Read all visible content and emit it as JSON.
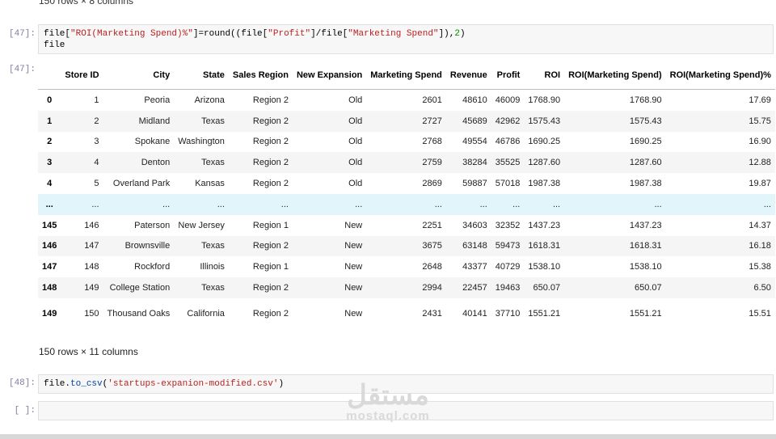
{
  "top_output": "150 rows × 8 columns",
  "cell47": {
    "prompt_in": "[47]:",
    "code_line1_parts": [
      "file[",
      "\"ROI(Marketing Spend)%\"",
      "]=round((file[",
      "\"Profit\"",
      "]/file[",
      "\"Marketing Spend\"",
      "]),",
      "2",
      ")"
    ],
    "code_line2": "file",
    "prompt_out": "[47]:"
  },
  "table": {
    "columns": [
      "",
      "Store ID",
      "City",
      "State",
      "Sales Region",
      "New Expansion",
      "Marketing Spend",
      "Revenue",
      "Profit",
      "ROI",
      "ROI(Marketing Spend)",
      "ROI(Marketing Spend)%"
    ],
    "rows": [
      [
        "0",
        "1",
        "Peoria",
        "Arizona",
        "Region 2",
        "Old",
        "2601",
        "48610",
        "46009",
        "1768.90",
        "1768.90",
        "17.69"
      ],
      [
        "1",
        "2",
        "Midland",
        "Texas",
        "Region 2",
        "Old",
        "2727",
        "45689",
        "42962",
        "1575.43",
        "1575.43",
        "15.75"
      ],
      [
        "2",
        "3",
        "Spokane",
        "Washington",
        "Region 2",
        "Old",
        "2768",
        "49554",
        "46786",
        "1690.25",
        "1690.25",
        "16.90"
      ],
      [
        "3",
        "4",
        "Denton",
        "Texas",
        "Region 2",
        "Old",
        "2759",
        "38284",
        "35525",
        "1287.60",
        "1287.60",
        "12.88"
      ],
      [
        "4",
        "5",
        "Overland Park",
        "Kansas",
        "Region 2",
        "Old",
        "2869",
        "59887",
        "57018",
        "1987.38",
        "1987.38",
        "19.87"
      ],
      [
        "...",
        "...",
        "...",
        "...",
        "...",
        "...",
        "...",
        "...",
        "...",
        "...",
        "...",
        "..."
      ],
      [
        "145",
        "146",
        "Paterson",
        "New Jersey",
        "Region 1",
        "New",
        "2251",
        "34603",
        "32352",
        "1437.23",
        "1437.23",
        "14.37"
      ],
      [
        "146",
        "147",
        "Brownsville",
        "Texas",
        "Region 2",
        "New",
        "3675",
        "63148",
        "59473",
        "1618.31",
        "1618.31",
        "16.18"
      ],
      [
        "147",
        "148",
        "Rockford",
        "Illinois",
        "Region 1",
        "New",
        "2648",
        "43377",
        "40729",
        "1538.10",
        "1538.10",
        "15.38"
      ],
      [
        "148",
        "149",
        "College Station",
        "Texas",
        "Region 2",
        "New",
        "2994",
        "22457",
        "19463",
        "650.07",
        "650.07",
        "6.50"
      ],
      [
        "149",
        "150",
        "Thousand Oaks",
        "California",
        "Region 2",
        "New",
        "2431",
        "40141",
        "37710",
        "1551.21",
        "1551.21",
        "15.51"
      ]
    ]
  },
  "shape_text": "150 rows × 11 columns",
  "cell48": {
    "prompt_in": "[48]:",
    "code_parts": [
      "file.",
      "to_csv",
      "(",
      "'startups-expanion-modified.csv'",
      ")"
    ]
  },
  "empty_cell": {
    "prompt_in": "[ ]:",
    "value": ""
  },
  "watermark": {
    "arabic": "مستقل",
    "latin": "mostaql.com"
  }
}
